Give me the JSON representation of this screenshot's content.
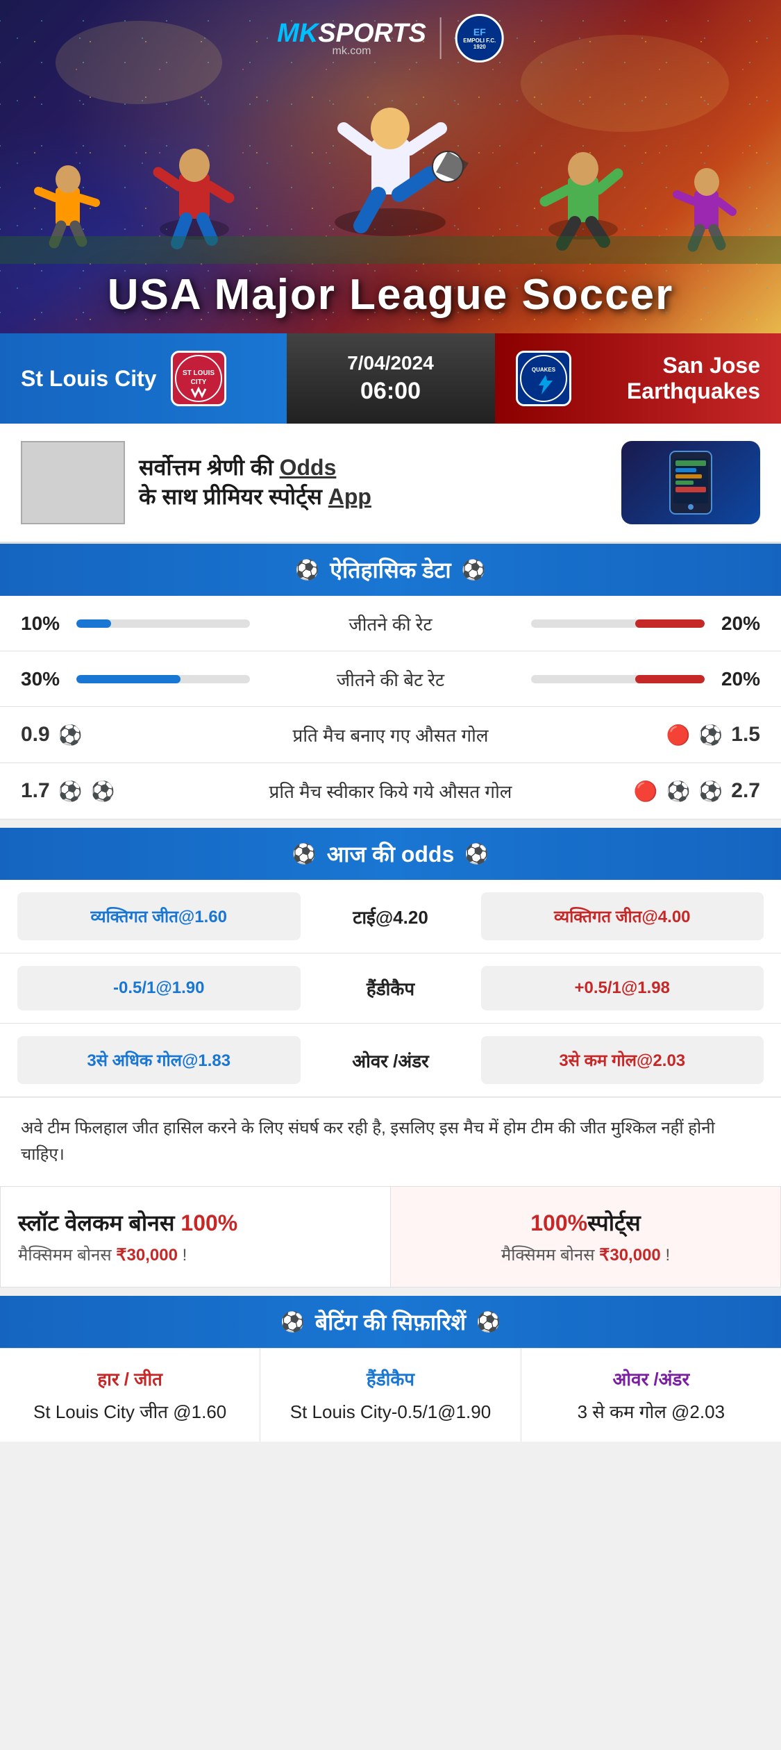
{
  "brand": {
    "name_mk": "MK",
    "name_sports": "SPORTS",
    "domain": "mk.com",
    "partner": "EMPOLI F.C.",
    "partner_year": "1920"
  },
  "hero": {
    "title": "USA Major League Soccer"
  },
  "match": {
    "date": "7/04/2024",
    "time": "06:00",
    "team_left": "St Louis City",
    "team_right": "San Jose Earthquakes",
    "team_right_short": "QUAKES"
  },
  "promo": {
    "text_line1": "सर्वोत्तम श्रेणी की",
    "text_odds": "Odds",
    "text_line2": "के साथ प्रीमियर स्पोर्ट्स",
    "text_app": "App"
  },
  "historical": {
    "section_title": "ऐतिहासिक डेटा",
    "stats": [
      {
        "label": "जीतने की रेट",
        "left_value": "10%",
        "right_value": "20%",
        "left_pct": 20,
        "right_pct": 40
      },
      {
        "label": "जीतने की बेट रेट",
        "left_value": "30%",
        "right_value": "20%",
        "left_pct": 60,
        "right_pct": 40
      }
    ],
    "goals": [
      {
        "label": "प्रति मैच बनाए गए औसत गोल",
        "left_value": "0.9",
        "right_value": "1.5",
        "left_balls": 1,
        "right_balls": 2
      },
      {
        "label": "प्रति मैच स्वीकार किये गये औसत गोल",
        "left_value": "1.7",
        "right_value": "2.7",
        "left_balls": 2,
        "right_balls": 3
      }
    ]
  },
  "odds": {
    "section_title": "आज की odds",
    "rows": [
      {
        "left_label": "व्यक्तिगत जीत@1.60",
        "center_label": "टाई@4.20",
        "right_label": "व्यक्तिगत जीत@4.00",
        "left_color": "blue",
        "right_color": "red"
      },
      {
        "left_label": "-0.5/1@1.90",
        "center_label": "हैंडीकैप",
        "right_label": "+0.5/1@1.98",
        "left_color": "blue",
        "right_color": "red"
      },
      {
        "left_label": "3से अधिक गोल@1.83",
        "center_label": "ओवर /अंडर",
        "right_label": "3से कम गोल@2.03",
        "left_color": "blue",
        "right_color": "red"
      }
    ]
  },
  "analysis": {
    "text": "अवे टीम फिलहाल जीत हासिल करने के लिए संघर्ष कर रही है, इसलिए इस मैच में होम टीम की जीत मुश्किल नहीं होनी चाहिए।"
  },
  "bonus": {
    "section1_title": "स्लॉट वेलकम बोनस 100%",
    "section1_subtitle": "मैक्सिमम बोनस ₹30,000  !",
    "section2_title": "100%स्पोर्ट्स",
    "section2_subtitle": "मैक्सिमम बोनस  ₹30,000 !"
  },
  "recommendations": {
    "section_title": "बेटिंग की सिफ़ारिशें",
    "cols": [
      {
        "type": "हार / जीत",
        "type_color": "red",
        "value": "St Louis City जीत @1.60"
      },
      {
        "type": "हैंडीकैप",
        "type_color": "blue",
        "value": "St Louis City-0.5/1@1.90"
      },
      {
        "type": "ओवर /अंडर",
        "type_color": "purple",
        "value": "3 से कम गोल @2.03"
      }
    ]
  }
}
